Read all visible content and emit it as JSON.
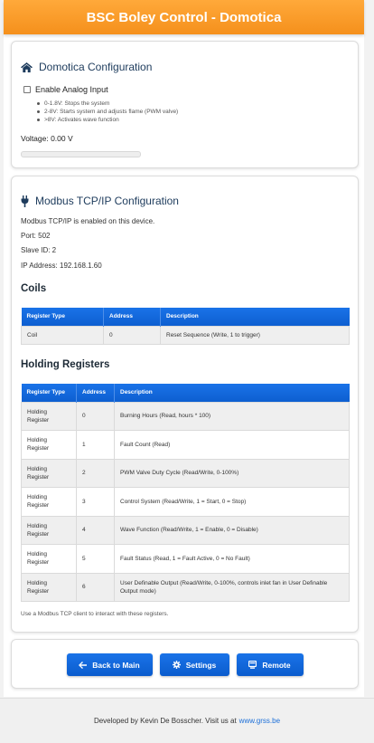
{
  "header": {
    "title": "BSC Boley Control - Domotica"
  },
  "domotica": {
    "title": "Domotica Configuration",
    "enable_label": "Enable Analog Input",
    "bullets": [
      "0-1.8V: Stops the system",
      "2-8V: Starts system and adjusts flame (PWM valve)",
      ">8V: Activates wave function"
    ],
    "voltage": "Voltage: 0.00 V",
    "voltage_level": 0
  },
  "modbus": {
    "title": "Modbus TCP/IP Configuration",
    "enabled_text": "Modbus TCP/IP is enabled on this device.",
    "port": "Port: 502",
    "slave_id": "Slave ID: 2",
    "ip": "IP Address: 192.168.1.60",
    "coils_title": "Coils",
    "holding_title": "Holding Registers",
    "columns": [
      "Register Type",
      "Address",
      "Description"
    ],
    "coils": [
      {
        "type": "Coil",
        "address": "0",
        "description": "Reset Sequence (Write, 1 to trigger)"
      }
    ],
    "holding": [
      {
        "type": "Holding Register",
        "address": "0",
        "description": "Burning Hours (Read, hours * 100)"
      },
      {
        "type": "Holding Register",
        "address": "1",
        "description": "Fault Count (Read)"
      },
      {
        "type": "Holding Register",
        "address": "2",
        "description": "PWM Valve Duty Cycle (Read/Write, 0-100%)"
      },
      {
        "type": "Holding Register",
        "address": "3",
        "description": "Control System (Read/Write, 1 = Start, 0 = Stop)"
      },
      {
        "type": "Holding Register",
        "address": "4",
        "description": "Wave Function (Read/Write, 1 = Enable, 0 = Disable)"
      },
      {
        "type": "Holding Register",
        "address": "5",
        "description": "Fault Status (Read, 1 = Fault Active, 0 = No Fault)"
      },
      {
        "type": "Holding Register",
        "address": "6",
        "description": "User Definable Output (Read/Write, 0-100%, controls inlet fan in User Definable Output mode)"
      }
    ],
    "note": "Use a Modbus TCP client to interact with these registers."
  },
  "buttons": {
    "back": "Back to Main",
    "settings": "Settings",
    "remote": "Remote"
  },
  "footer": {
    "text": "Developed by Kevin De Bosscher. Visit us at",
    "link": "www.grss.be"
  },
  "colors": {
    "header": "#f5901c",
    "accent": "#1a73e8",
    "title": "#1d3b5c"
  }
}
